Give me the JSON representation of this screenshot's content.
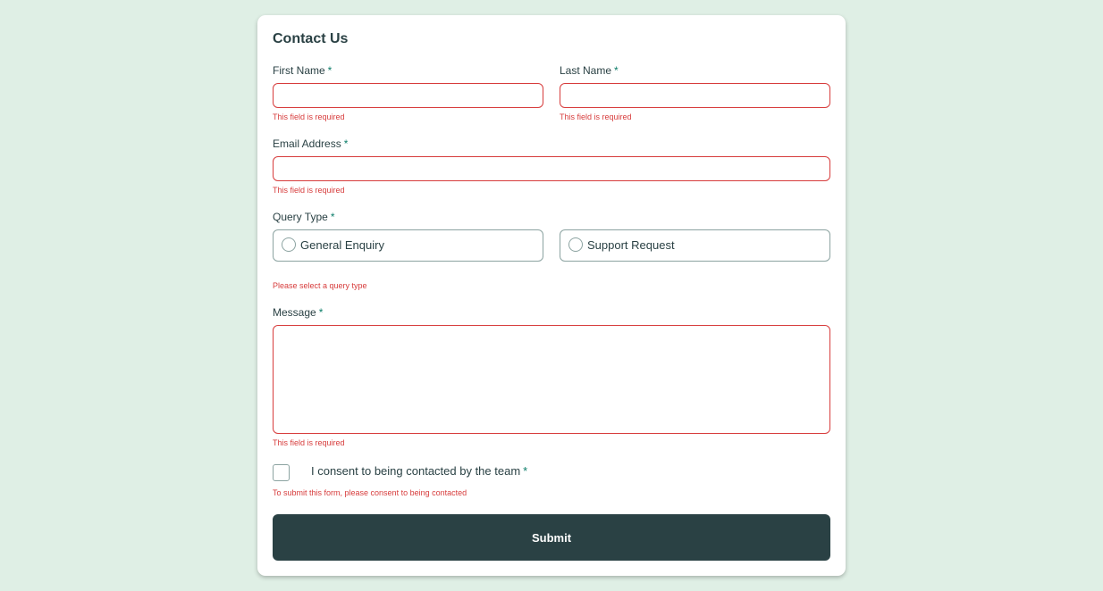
{
  "form": {
    "title": "Contact Us",
    "required_marker": "*",
    "first_name": {
      "label": "First Name",
      "value": "",
      "error": "This field is required"
    },
    "last_name": {
      "label": "Last Name",
      "value": "",
      "error": "This field is required"
    },
    "email": {
      "label": "Email Address",
      "value": "",
      "error": "This field is required"
    },
    "query_type": {
      "label": "Query Type",
      "options": [
        {
          "label": "General Enquiry",
          "selected": false
        },
        {
          "label": "Support Request",
          "selected": false
        }
      ],
      "error": "Please select a query type"
    },
    "message": {
      "label": "Message",
      "value": "",
      "error": "This field is required"
    },
    "consent": {
      "label": "I consent to being contacted by the team",
      "checked": false,
      "error": "To submit this form, please consent to being contacted"
    },
    "submit_label": "Submit"
  },
  "colors": {
    "page_background": "#dfefe5",
    "card_background": "#ffffff",
    "text": "#2a4144",
    "accent": "#0c7d69",
    "error": "#d73c3c",
    "border": "#8ca3a1",
    "button": "#2a4144"
  }
}
